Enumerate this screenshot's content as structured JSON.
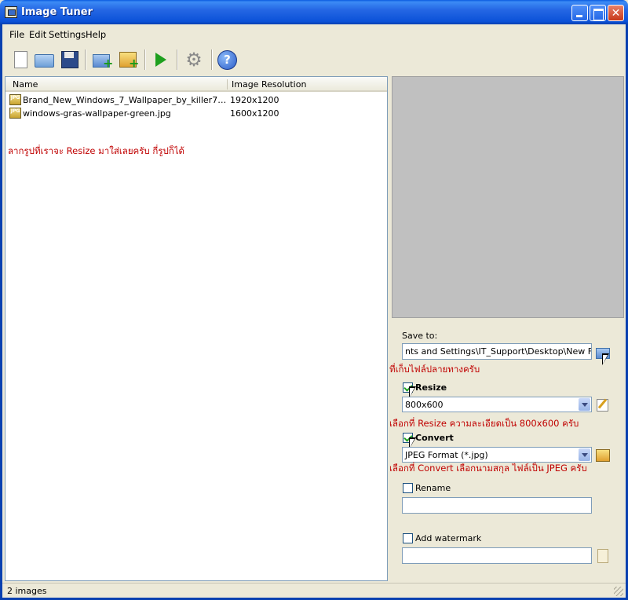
{
  "window": {
    "title": "Image Tuner"
  },
  "menu": {
    "file": "File",
    "edit": "Edit",
    "settings": "Settings",
    "help": "Help"
  },
  "toolbar": {
    "buttons": [
      "new-icon",
      "open-icon",
      "save-icon",
      "add-folder-icon",
      "add-image-icon",
      "run-icon",
      "settings-gear-icon",
      "help-icon"
    ],
    "settings_glyph": "⚙"
  },
  "file_list": {
    "columns": [
      "Name",
      "Image Resolution"
    ],
    "rows": [
      {
        "name": "Brand_New_Windows_7_Wallpaper_by_killer7ben....",
        "resolution": "1920x1200",
        "icon_text": "JPG"
      },
      {
        "name": "windows-gras-wallpaper-green.jpg",
        "resolution": "1600x1200",
        "icon_text": "JPG"
      }
    ],
    "annotation": "ลากรูปที่เราจะ Resize มาใส่เลยครับ กี่รูปก็ได้"
  },
  "panel": {
    "save_to_label": "Save to:",
    "save_to_value": "nts and Settings\\IT_Support\\Desktop\\New Folder",
    "save_annotation": "ที่เก็บไฟล์ปลายทางครับ",
    "resize_label": "Resize",
    "resize_checked": true,
    "resize_value": "800x600",
    "resize_annotation": "เลือกที่ Resize ความละเอียดเป็น 800x600 ครับ",
    "convert_label": "Convert",
    "convert_checked": true,
    "convert_value": "JPEG Format (*.jpg)",
    "convert_annotation": "เลือกที่ Convert เลือกนามสกุล ไฟล์เป็น JPEG ครับ",
    "rename_label": "Rename",
    "rename_checked": false,
    "rename_value": "",
    "watermark_label": "Add watermark",
    "watermark_checked": false,
    "watermark_value": ""
  },
  "status": {
    "text": "2 images"
  },
  "colors": {
    "annotation": "#c00000",
    "titlebar": "#2567e4",
    "preview_bg": "#c0c0c0"
  }
}
